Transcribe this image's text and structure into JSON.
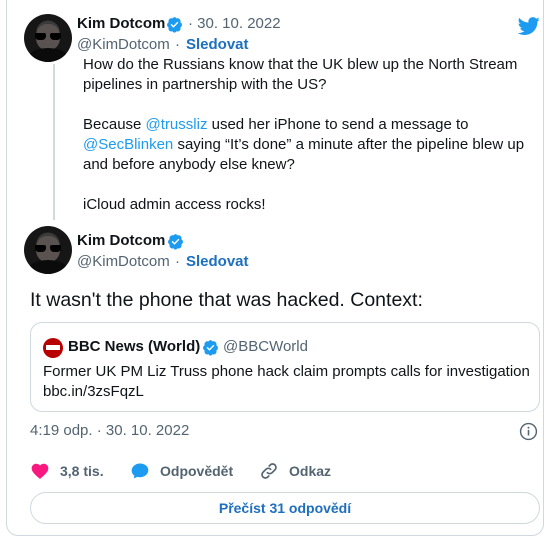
{
  "first_tweet": {
    "author_name": "Kim Dotcom",
    "date": "· 30. 10. 2022",
    "handle": "@KimDotcom",
    "separator": "·",
    "follow_label": "Sledovat",
    "line1": "How do the Russians know that the UK blew up the North Stream pipelines in partnership with the US?",
    "p2_before": "Because ",
    "mention1": "@trussliz",
    "p2_middle": " used her iPhone to send a message to ",
    "mention2": "@SecBlinken",
    "p2_after": " saying “It’s done” a minute after the pipeline blew up and before anybody else knew?",
    "line3": "iCloud admin access rocks!"
  },
  "second_tweet": {
    "author_name": "Kim Dotcom",
    "handle": "@KimDotcom",
    "separator": "·",
    "follow_label": "Sledovat",
    "text": "It wasn't the phone that was hacked. Context:",
    "quote": {
      "name": "BBC News (World)",
      "handle": "@BBCWorld",
      "text": "Former UK PM Liz Truss phone hack claim prompts calls for investigation",
      "link": "bbc.in/3zsFqzL"
    },
    "timestamp": "4:19 odp. · 30. 10. 2022",
    "actions": {
      "like_count": "3,8 tis.",
      "reply_label": "Odpovědět",
      "share_label": "Odkaz"
    },
    "read_replies_label": "Přečíst 31 odpovědí"
  },
  "icons": {
    "brand": "twitter-bird-icon",
    "verified": "verified-badge-icon",
    "like": "heart-icon",
    "reply": "speech-bubble-icon",
    "share": "link-icon",
    "info": "info-icon"
  },
  "colors": {
    "accent": "#1d9bf0",
    "heart": "#f91880",
    "text_secondary": "#536471",
    "bbc_red": "#b80000"
  }
}
